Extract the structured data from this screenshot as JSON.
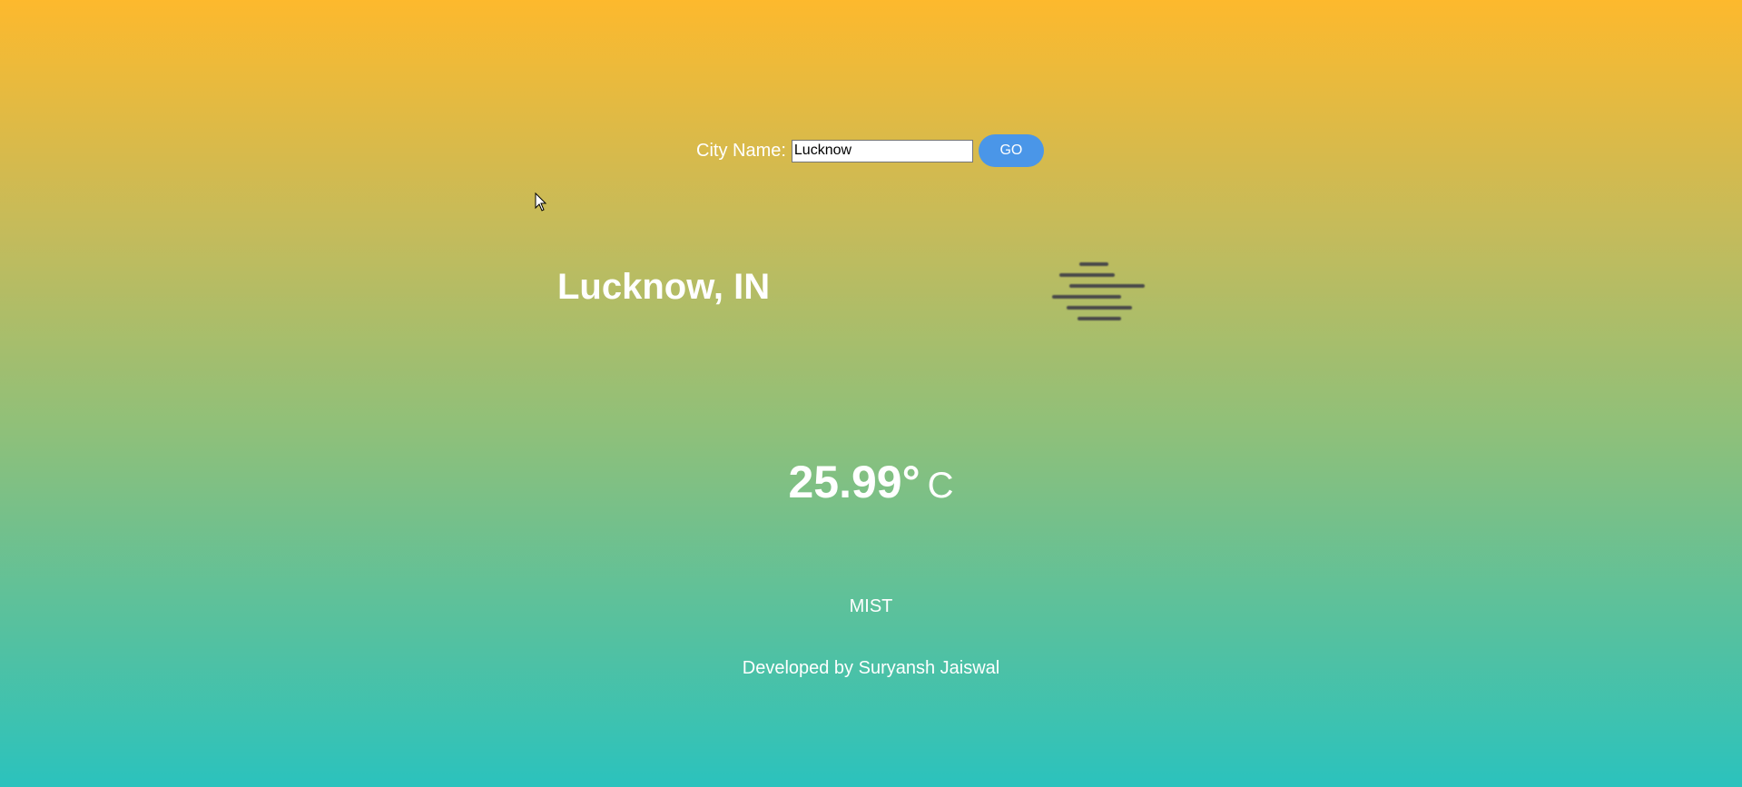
{
  "search": {
    "label": "City Name:",
    "value": "Lucknow",
    "button_label": "GO"
  },
  "weather": {
    "location": "Lucknow, IN",
    "icon": "mist-icon",
    "temperature": "25.99°",
    "unit": "C",
    "condition": "MIST"
  },
  "footer": {
    "credit": "Developed by Suryansh Jaiswal"
  },
  "colors": {
    "gradient_top": "#fdb92d",
    "gradient_bottom": "#2bc2bd",
    "button": "#4a96e8",
    "text": "#ffffff",
    "icon": "#4a4a4a"
  }
}
